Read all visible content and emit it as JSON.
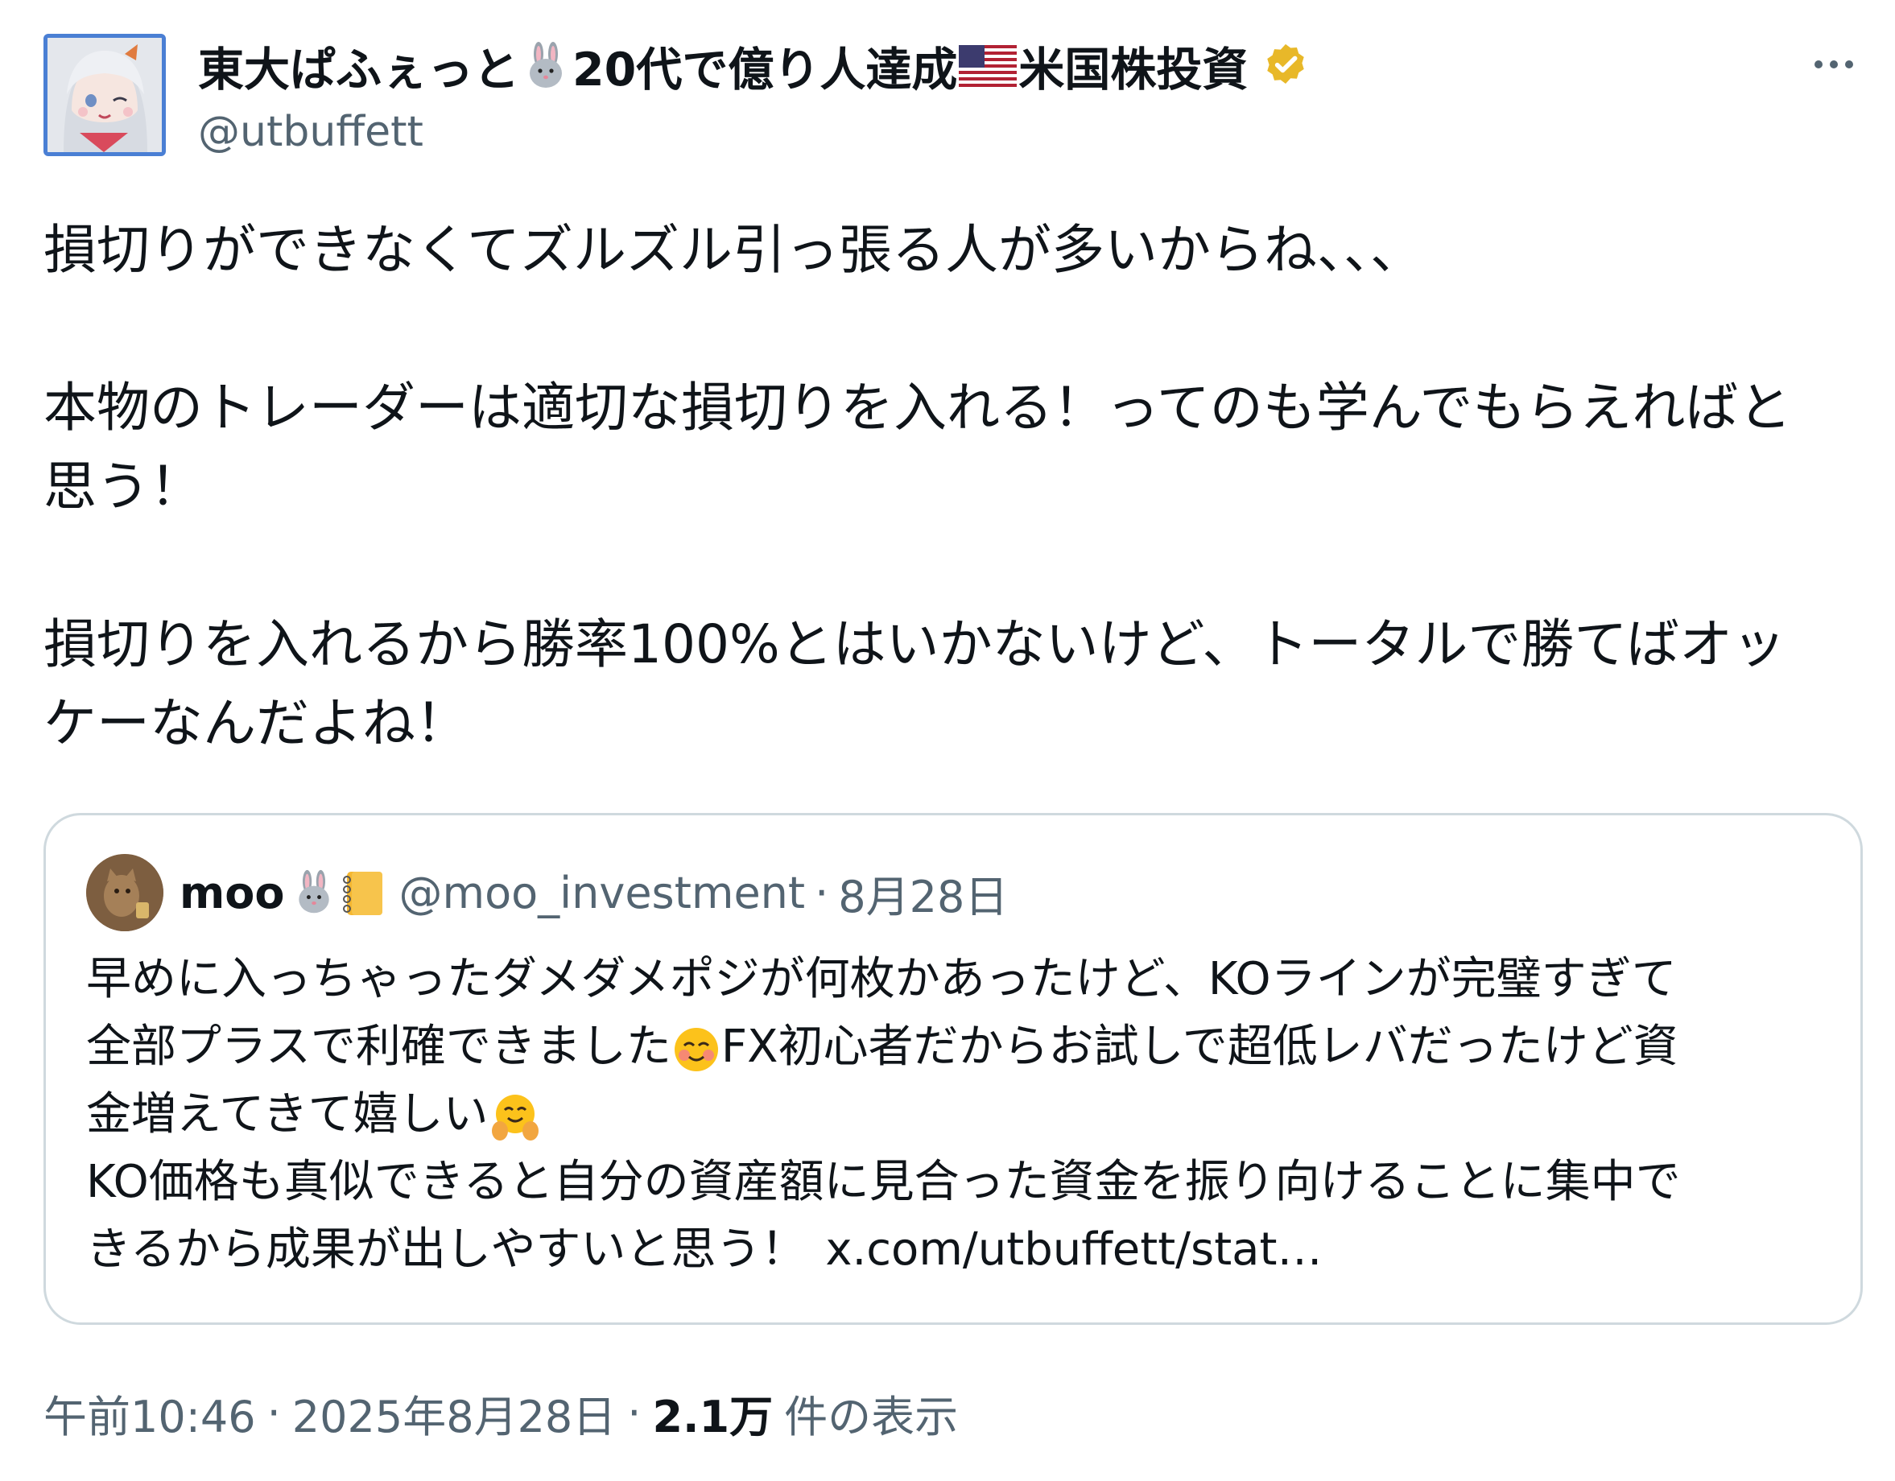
{
  "author": {
    "display_name_part1": "東大ぱふぇっと",
    "display_name_part2": "20代で億り人達成",
    "display_name_part3": "米国株投資",
    "handle": "@utbuffett",
    "badges": [
      "rabbit-emoji",
      "us-flag-emoji",
      "verified-badge"
    ]
  },
  "post": {
    "line1": "損切りができなくてズルズル引っ張る人が多いからね、、、",
    "line2": "本物のトレーダーは適切な損切りを入れる！ってのも学んでもらえればと",
    "line3": "思う！",
    "line4": "損切りを入れるから勝率100%とはいかないけど、トータルで勝てばオッ",
    "line5": "ケーなんだよね！"
  },
  "quote": {
    "name": "moo",
    "handle": "@moo_investment",
    "separator": "·",
    "date": "8月28日",
    "line1": "早めに入っちゃったダメダメポジが何枚かあったけど、KOラインが完璧すぎて",
    "line2a": "全部プラスで利確できました",
    "line2b": "FX初心者だからお試しで超低レバだったけど資",
    "line3": "金増えてきて嬉しい",
    "line4": "KO価格も真似できると自分の資産額に見合った資金を振り向けることに集中で",
    "line5": "きるから成果が出しやすいと思う！",
    "link": "x.com/utbuffett/stat…"
  },
  "meta": {
    "time": "午前10:46",
    "separator": "·",
    "date": "2025年8月28日",
    "views_count": "2.1万",
    "views_label": "件の表示"
  },
  "colors": {
    "text": "#0f1419",
    "secondary": "#536471",
    "border": "#cfd9de",
    "verified_gold": "#e8b829"
  }
}
